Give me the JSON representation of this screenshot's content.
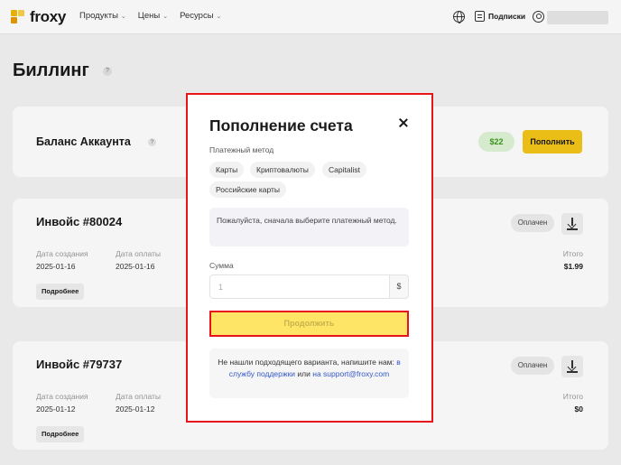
{
  "header": {
    "logo_text": "froxy",
    "nav": [
      {
        "label": "Продукты"
      },
      {
        "label": "Цены"
      },
      {
        "label": "Ресурсы"
      }
    ],
    "subscriptions_label": "Подписки"
  },
  "page": {
    "title": "Биллинг",
    "help_glyph": "?"
  },
  "balance": {
    "title": "Баланс Аккаунта",
    "amount": "$22",
    "topup_label": "Пополнить"
  },
  "invoices": [
    {
      "title": "Инвойс #80024",
      "created_label": "Дата создания",
      "created": "2025-01-16",
      "paid_label": "Дата оплаты",
      "paid": "2025-01-16",
      "total_label": "Итого",
      "total": "$1.99",
      "status": "Оплачен",
      "details_label": "Подробнее"
    },
    {
      "title": "Инвойс #79737",
      "created_label": "Дата создания",
      "created": "2025-01-12",
      "paid_label": "Дата оплаты",
      "paid": "2025-01-12",
      "total_label": "Итого",
      "total": "$0",
      "status": "Оплачен",
      "details_label": "Подробнее"
    }
  ],
  "modal": {
    "title": "Пополнение счета",
    "payment_method_label": "Платежный метод",
    "methods": [
      "Карты",
      "Криптовалюты",
      "Capitalist",
      "Российские карты"
    ],
    "notice": "Пожалуйста, сначала выберите платежный метод.",
    "amount_label": "Сумма",
    "amount_placeholder": "1",
    "currency": "$",
    "continue_label": "Продолжить",
    "help_prefix": "Не нашли подходящего варианта, напишите нам:",
    "help_link_support": "в службу поддержки",
    "help_or": "или",
    "help_link_email": "на support@froxy.com"
  }
}
